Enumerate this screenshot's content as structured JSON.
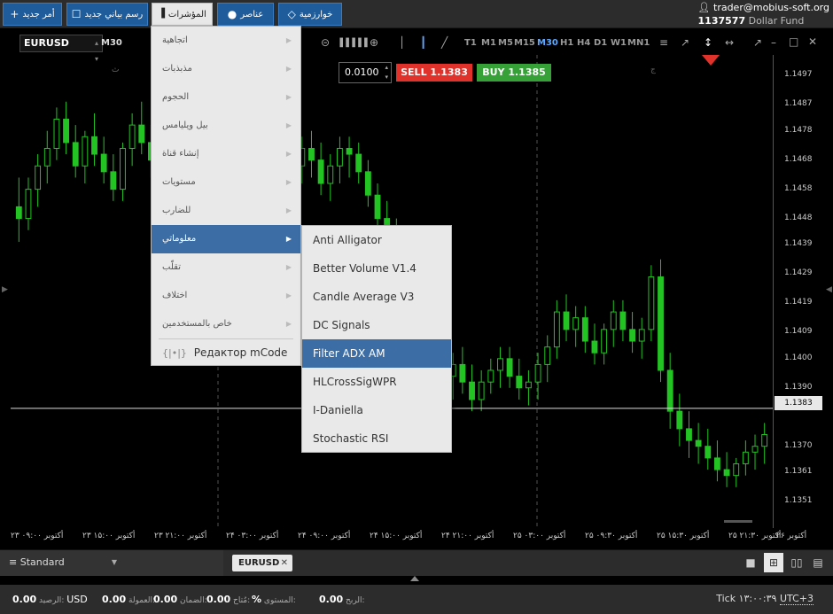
{
  "topbar": {
    "buttons": [
      {
        "label": "أمر جديد",
        "icon": "plus-icon"
      },
      {
        "label": "رسم بياني جديد",
        "icon": "chart-icon"
      },
      {
        "label": "المؤشرات",
        "icon": "bars-icon"
      },
      {
        "label": "عناصر",
        "icon": "shapes-icon"
      },
      {
        "label": "خوارزمية",
        "icon": "diamond-icon"
      }
    ],
    "user": "trader@mobius-soft.org",
    "account_number": "1137577",
    "account_name": "Dollar Fund"
  },
  "chart_toolbar": {
    "symbol": "EURUSD",
    "timeframe_current": "M30",
    "timeframes": [
      "T1",
      "M1",
      "M5",
      "M15",
      "M30",
      "H1",
      "H4",
      "D1",
      "W1",
      "MN1"
    ],
    "selected_timeframe": "M30"
  },
  "trade": {
    "lot": "0.0100",
    "sell_label": "SELL 1.1383",
    "buy_label": "BUY 1.1385"
  },
  "indicators_menu": {
    "items": [
      {
        "label": "اتجاهية"
      },
      {
        "label": "مذبذبات"
      },
      {
        "label": "الحجوم"
      },
      {
        "label": "بيل ويليامس"
      },
      {
        "label": "إنشاء قناة"
      },
      {
        "label": "مستويات"
      },
      {
        "label": "للضارب"
      },
      {
        "label": "معلوماتي",
        "selected": true
      },
      {
        "label": "تقلّب"
      },
      {
        "label": "اختلاف"
      },
      {
        "label": "خاص بالمستخدمين"
      }
    ],
    "mcode_label": "Редактор mCode",
    "submenu": [
      {
        "label": "Anti Alligator"
      },
      {
        "label": "Better Volume V1.4"
      },
      {
        "label": "Candle Average V3"
      },
      {
        "label": "DC Signals"
      },
      {
        "label": "Filter ADX AM",
        "selected": true
      },
      {
        "label": "HLCrossSigWPR"
      },
      {
        "label": "I-Daniella"
      },
      {
        "label": "Stochastic RSI"
      }
    ]
  },
  "chart_data": {
    "type": "candlestick",
    "symbol": "EURUSD",
    "timeframe": "M30",
    "y_ticks": [
      "1.1497",
      "1.1487",
      "1.1478",
      "1.1468",
      "1.1458",
      "1.1448",
      "1.1439",
      "1.1429",
      "1.1419",
      "1.1409",
      "1.1400",
      "1.1390",
      "1.1361",
      "1.1370",
      "1.1351"
    ],
    "current_price": "1.1383",
    "x_labels": [
      "۲۳ أكتوبر ۰۹:۰۰",
      "۲۳ أكتوبر ۱۵:۰۰",
      "۲۳ أكتوبر ۲۱:۰۰",
      "۲۴ أكتوبر ۰۳:۰۰",
      "۲۴ أكتوبر ۰۹:۰۰",
      "۲۴ أكتوبر ۱۵:۰۰",
      "۲۴ أكتوبر ۲۱:۰۰",
      "۲۵ أكتوبر ۰۳:۰۰",
      "۲۵ أكتوبر ۰۹:۳۰",
      "۲۵ أكتوبر ۱۵:۳۰",
      "۲۵ أكتوبر ۲۱:۳۰",
      "۲۶ أكتوبر"
    ],
    "day_markers": [
      "ث",
      "ج"
    ],
    "candles": [
      [
        1.1452,
        1.1462,
        1.144,
        1.1448
      ],
      [
        1.1448,
        1.1462,
        1.1444,
        1.1458
      ],
      [
        1.1458,
        1.147,
        1.1452,
        1.1466
      ],
      [
        1.1466,
        1.1478,
        1.146,
        1.1472
      ],
      [
        1.1472,
        1.1486,
        1.1468,
        1.1482
      ],
      [
        1.1482,
        1.1488,
        1.147,
        1.1474
      ],
      [
        1.1474,
        1.148,
        1.1462,
        1.1466
      ],
      [
        1.1466,
        1.1478,
        1.146,
        1.1476
      ],
      [
        1.1476,
        1.1484,
        1.1466,
        1.147
      ],
      [
        1.147,
        1.1476,
        1.146,
        1.1464
      ],
      [
        1.1464,
        1.147,
        1.1454,
        1.1458
      ],
      [
        1.1458,
        1.1474,
        1.1454,
        1.1472
      ],
      [
        1.1472,
        1.1484,
        1.1466,
        1.148
      ],
      [
        1.148,
        1.1488,
        1.147,
        1.1474
      ],
      [
        1.1474,
        1.148,
        1.1462,
        1.1468
      ],
      [
        1.1468,
        1.1474,
        1.1452,
        1.1458
      ],
      [
        1.1458,
        1.147,
        1.145,
        1.1466
      ],
      [
        1.1466,
        1.1484,
        1.1462,
        1.1482
      ],
      [
        1.1482,
        1.1488,
        1.147,
        1.1476
      ],
      [
        1.1476,
        1.148,
        1.1464,
        1.1468
      ],
      [
        1.1468,
        1.1476,
        1.1458,
        1.1472
      ],
      [
        1.1472,
        1.148,
        1.1462,
        1.1466
      ],
      [
        1.1466,
        1.1472,
        1.1452,
        1.1456
      ],
      [
        1.1456,
        1.1466,
        1.1448,
        1.1462
      ],
      [
        1.1462,
        1.1468,
        1.1452,
        1.1456
      ],
      [
        1.1456,
        1.1464,
        1.1446,
        1.146
      ],
      [
        1.146,
        1.149,
        1.1456,
        1.1486
      ],
      [
        1.1486,
        1.1494,
        1.1472,
        1.1476
      ],
      [
        1.1476,
        1.1482,
        1.1458,
        1.1462
      ],
      [
        1.1462,
        1.147,
        1.145,
        1.1466
      ],
      [
        1.1466,
        1.1476,
        1.146,
        1.1472
      ],
      [
        1.1472,
        1.1478,
        1.1462,
        1.1468
      ],
      [
        1.1468,
        1.1474,
        1.1456,
        1.146
      ],
      [
        1.146,
        1.147,
        1.1454,
        1.1466
      ],
      [
        1.1466,
        1.1476,
        1.146,
        1.1472
      ],
      [
        1.1472,
        1.1476,
        1.1462,
        1.147
      ],
      [
        1.147,
        1.1474,
        1.146,
        1.1464
      ],
      [
        1.1464,
        1.1468,
        1.1452,
        1.1456
      ],
      [
        1.1456,
        1.146,
        1.1444,
        1.1448
      ],
      [
        1.1448,
        1.1454,
        1.1438,
        1.1442
      ],
      [
        1.1442,
        1.1448,
        1.143,
        1.1434
      ],
      [
        1.1434,
        1.144,
        1.1422,
        1.1426
      ],
      [
        1.1426,
        1.1432,
        1.1414,
        1.1418
      ],
      [
        1.1418,
        1.1422,
        1.1404,
        1.1408
      ],
      [
        1.1408,
        1.1414,
        1.1396,
        1.1402
      ],
      [
        1.1402,
        1.1406,
        1.139,
        1.1394
      ],
      [
        1.1394,
        1.1402,
        1.1386,
        1.1398
      ],
      [
        1.1398,
        1.1404,
        1.1388,
        1.1392
      ],
      [
        1.1392,
        1.1398,
        1.1382,
        1.1386
      ],
      [
        1.1386,
        1.1396,
        1.1382,
        1.1392
      ],
      [
        1.1392,
        1.14,
        1.1388,
        1.1396
      ],
      [
        1.1396,
        1.1404,
        1.139,
        1.14
      ],
      [
        1.14,
        1.1404,
        1.139,
        1.1394
      ],
      [
        1.1394,
        1.14,
        1.1386,
        1.139
      ],
      [
        1.139,
        1.1396,
        1.1384,
        1.1392
      ],
      [
        1.1392,
        1.1402,
        1.1386,
        1.1398
      ],
      [
        1.1398,
        1.1408,
        1.1392,
        1.1404
      ],
      [
        1.1404,
        1.142,
        1.14,
        1.1416
      ],
      [
        1.1416,
        1.1422,
        1.1406,
        1.141
      ],
      [
        1.141,
        1.1418,
        1.1404,
        1.1414
      ],
      [
        1.1414,
        1.1418,
        1.1402,
        1.1406
      ],
      [
        1.1406,
        1.1412,
        1.1398,
        1.1402
      ],
      [
        1.1402,
        1.1412,
        1.1398,
        1.141
      ],
      [
        1.141,
        1.142,
        1.1404,
        1.1416
      ],
      [
        1.1416,
        1.142,
        1.1406,
        1.141
      ],
      [
        1.141,
        1.1416,
        1.1402,
        1.1406
      ],
      [
        1.1406,
        1.1414,
        1.14,
        1.141
      ],
      [
        1.141,
        1.1432,
        1.1406,
        1.1428
      ],
      [
        1.1428,
        1.1434,
        1.1392,
        1.1396
      ],
      [
        1.1396,
        1.1402,
        1.1376,
        1.1382
      ],
      [
        1.1382,
        1.1388,
        1.137,
        1.1376
      ],
      [
        1.1376,
        1.1382,
        1.1366,
        1.1372
      ],
      [
        1.1372,
        1.1378,
        1.1364,
        1.137
      ],
      [
        1.137,
        1.1376,
        1.1362,
        1.1366
      ],
      [
        1.1366,
        1.1372,
        1.1358,
        1.1362
      ],
      [
        1.1362,
        1.1368,
        1.1356,
        1.136
      ],
      [
        1.136,
        1.1366,
        1.1356,
        1.1364
      ],
      [
        1.1364,
        1.1372,
        1.136,
        1.1368
      ],
      [
        1.1368,
        1.1374,
        1.1362,
        1.137
      ],
      [
        1.137,
        1.1378,
        1.1364,
        1.1374
      ]
    ]
  },
  "tabbar": {
    "layout": "Standard",
    "tab": "EURUSD"
  },
  "status": {
    "balance_label": "الرصيد:",
    "balance": "0.00",
    "currency": "USD",
    "commission_label": "العمولة:",
    "commission": "0.00",
    "margin_label": "الضمان:",
    "margin": "0.00",
    "free_label": "مُتاح:",
    "free": "0.00",
    "level_label": "المستوى:",
    "level": "%",
    "profit_label": "الربح:",
    "profit": "0.00",
    "tick_label": "Tick",
    "time": "۱۳:۰۰:۳۹",
    "timezone": "UTC+3"
  }
}
